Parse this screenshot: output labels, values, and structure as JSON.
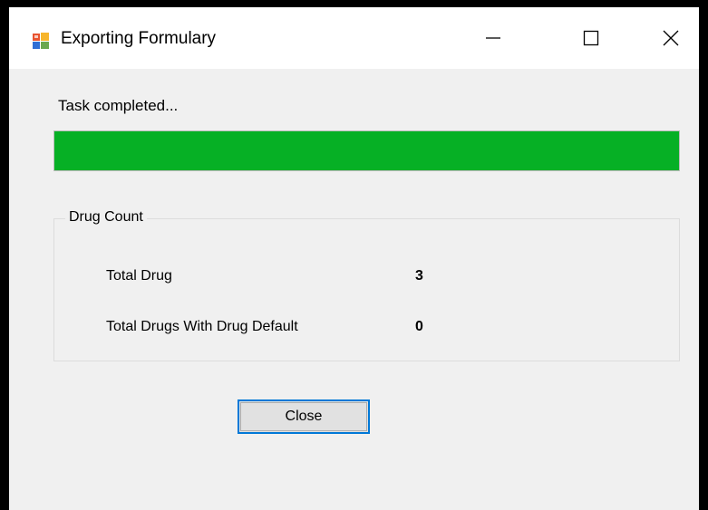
{
  "window": {
    "title": "Exporting Formulary",
    "controls": {
      "minimize": "minimize-icon",
      "maximize": "maximize-icon",
      "close": "close-icon"
    }
  },
  "status": {
    "message": "Task completed...",
    "progress_percent": 100,
    "progress_color": "#06b025"
  },
  "drug_count": {
    "group_title": "Drug Count",
    "rows": [
      {
        "label": "Total Drug",
        "value": "3"
      },
      {
        "label": "Total Drugs With Drug Default",
        "value": "0"
      }
    ]
  },
  "actions": {
    "close_label": "Close"
  }
}
